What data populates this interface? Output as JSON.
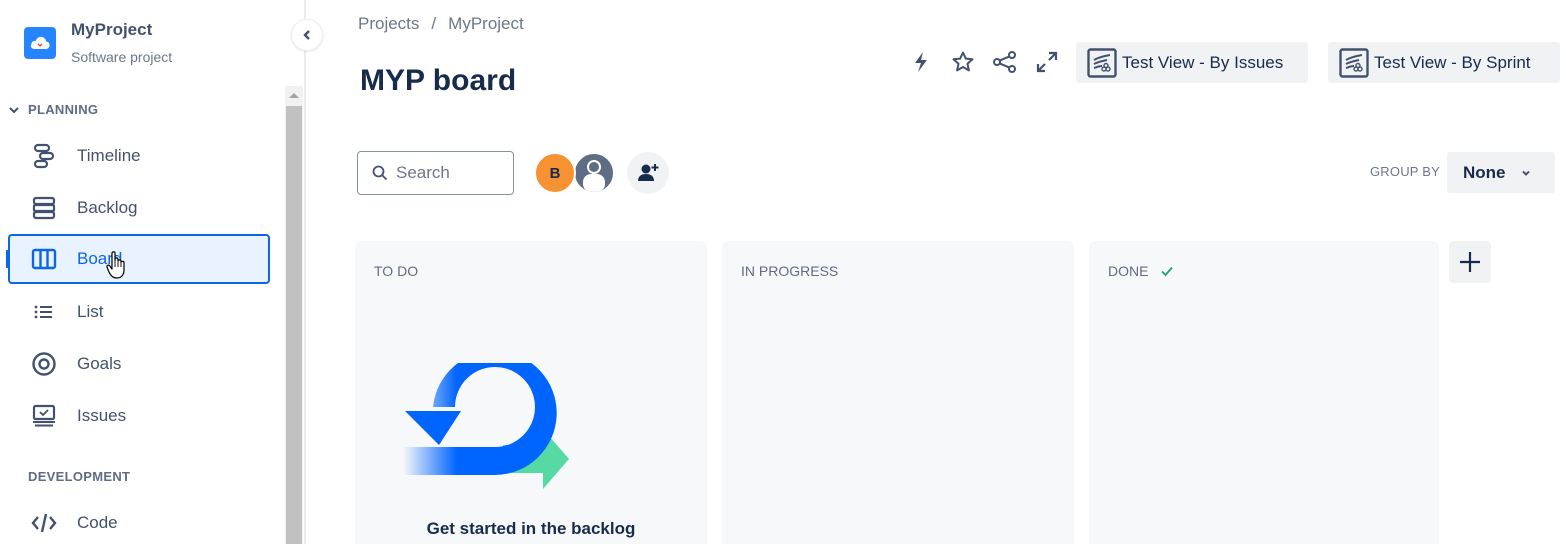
{
  "sidebar": {
    "project": {
      "name": "MyProject",
      "type": "Software project",
      "logo_icon": "cloud-icon",
      "logo_color": "#2684ff"
    },
    "collapse_icon": "chevron-left-icon",
    "sections": [
      {
        "label": "PLANNING",
        "expanded": true,
        "items": [
          {
            "label": "Timeline",
            "icon": "timeline-icon",
            "active": false
          },
          {
            "label": "Backlog",
            "icon": "backlog-icon",
            "active": false
          },
          {
            "label": "Board",
            "icon": "board-icon",
            "active": true
          },
          {
            "label": "List",
            "icon": "list-icon",
            "active": false
          },
          {
            "label": "Goals",
            "icon": "goals-icon",
            "active": false
          },
          {
            "label": "Issues",
            "icon": "issues-icon",
            "active": false
          }
        ]
      },
      {
        "label": "DEVELOPMENT",
        "items": [
          {
            "label": "Code",
            "icon": "code-icon",
            "active": false
          }
        ]
      }
    ]
  },
  "header": {
    "breadcrumb": [
      "Projects",
      "MyProject"
    ],
    "breadcrumb_sep": "/",
    "title": "MYP board",
    "actions": [
      {
        "name": "automation",
        "icon": "lightning-icon"
      },
      {
        "name": "star",
        "icon": "star-icon"
      },
      {
        "name": "share",
        "icon": "share-icon"
      },
      {
        "name": "fullscreen",
        "icon": "expand-icon"
      }
    ],
    "views": [
      {
        "label": "Test View - By Issues",
        "icon": "custom-view-icon"
      },
      {
        "label": "Test View - By Sprint",
        "icon": "custom-view-icon"
      }
    ]
  },
  "toolbar": {
    "search_placeholder": "Search",
    "search_value": "",
    "avatars": [
      {
        "initial": "B",
        "color": "#f79233"
      },
      {
        "initial": "",
        "color": "#5e6c84"
      }
    ],
    "add_people_icon": "add-person-icon",
    "group_by_label": "GROUP BY",
    "group_by_value": "None"
  },
  "board": {
    "columns": [
      {
        "title": "TO DO",
        "done": false
      },
      {
        "title": "IN PROGRESS",
        "done": false
      },
      {
        "title": "DONE",
        "done": true
      }
    ],
    "empty_state_text": "Get started in the backlog",
    "add_column_icon": "plus-icon",
    "accent": "#0c66e4",
    "done_check_color": "#22a06b"
  }
}
